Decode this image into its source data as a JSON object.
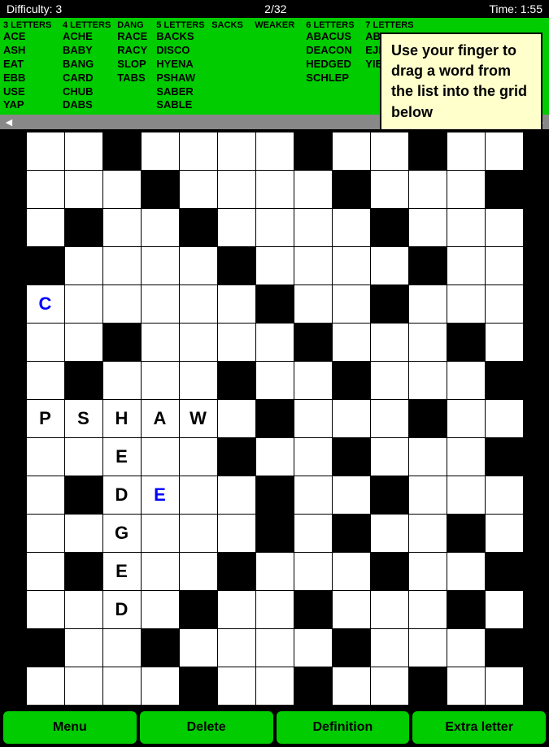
{
  "header": {
    "difficulty": "Difficulty: 3",
    "progress": "2/32",
    "time": "Time: 1:55"
  },
  "word_list": {
    "columns": [
      {
        "header": "3 LETTERS",
        "words": [
          "ACE",
          "ASH",
          "EAT",
          "EBB",
          "USE",
          "YAP"
        ]
      },
      {
        "header": "4 LETTERS",
        "words": [
          "ACHE",
          "BABY",
          "BANG",
          "CARD",
          "CHUB",
          "DABS"
        ]
      },
      {
        "header": "DANG",
        "words": [
          "RACE",
          "RACY",
          "SLOP",
          "TABS",
          "SABER",
          "SABLE"
        ]
      },
      {
        "header": "5 LETTERS",
        "words": [
          "BACKS",
          "DISCO",
          "HYENA",
          "PSHAW",
          "SABER",
          "SABLE"
        ]
      },
      {
        "header": "SACKS",
        "words": []
      },
      {
        "header": "WEAKER",
        "words": []
      },
      {
        "header": "6 LETTERS",
        "words": [
          "ABACUS",
          "DEACON",
          "HEDGED",
          "SCHLEP"
        ]
      },
      {
        "header": "7 LETTERS",
        "words": [
          "ABANDON",
          "EJECTED",
          "YIELDED"
        ]
      }
    ]
  },
  "tooltip": {
    "text": "Use your finger to drag a word from the list into the grid below"
  },
  "scroll": {
    "left_arrow": "◄",
    "right_arrow": "►"
  },
  "grid": {
    "rows": 15,
    "cols": 13,
    "cells": [
      [
        0,
        0,
        1,
        0,
        0,
        0,
        0,
        1,
        0,
        0,
        1,
        0,
        0
      ],
      [
        0,
        0,
        0,
        1,
        0,
        0,
        0,
        0,
        1,
        0,
        0,
        0,
        1
      ],
      [
        0,
        1,
        0,
        0,
        1,
        0,
        0,
        0,
        0,
        1,
        0,
        0,
        0
      ],
      [
        1,
        0,
        0,
        0,
        0,
        1,
        0,
        0,
        0,
        0,
        1,
        0,
        0
      ],
      [
        "C",
        0,
        0,
        0,
        0,
        0,
        1,
        0,
        0,
        1,
        0,
        0,
        0
      ],
      [
        0,
        0,
        1,
        0,
        0,
        0,
        0,
        1,
        0,
        0,
        0,
        1,
        0
      ],
      [
        0,
        1,
        0,
        0,
        0,
        1,
        0,
        0,
        1,
        0,
        0,
        0,
        1
      ],
      [
        "P",
        "S",
        "H",
        "A",
        "W",
        0,
        1,
        0,
        0,
        0,
        1,
        0,
        0
      ],
      [
        0,
        0,
        "E",
        0,
        0,
        1,
        0,
        0,
        1,
        0,
        0,
        0,
        1
      ],
      [
        0,
        1,
        "D",
        "E_BLUE",
        0,
        0,
        1,
        0,
        0,
        1,
        0,
        0,
        0
      ],
      [
        0,
        0,
        "G",
        0,
        0,
        0,
        1,
        0,
        1,
        0,
        0,
        1,
        0
      ],
      [
        0,
        1,
        "E",
        0,
        0,
        1,
        0,
        0,
        0,
        1,
        0,
        0,
        1
      ],
      [
        0,
        0,
        "D",
        0,
        1,
        0,
        0,
        1,
        0,
        0,
        0,
        1,
        0
      ],
      [
        1,
        0,
        0,
        1,
        0,
        0,
        0,
        0,
        1,
        0,
        0,
        0,
        1
      ],
      [
        0,
        0,
        0,
        0,
        1,
        0,
        0,
        1,
        0,
        0,
        1,
        0,
        0
      ]
    ]
  },
  "toolbar": {
    "menu_label": "Menu",
    "delete_label": "Delete",
    "definition_label": "Definition",
    "extra_letter_label": "Extra letter"
  }
}
